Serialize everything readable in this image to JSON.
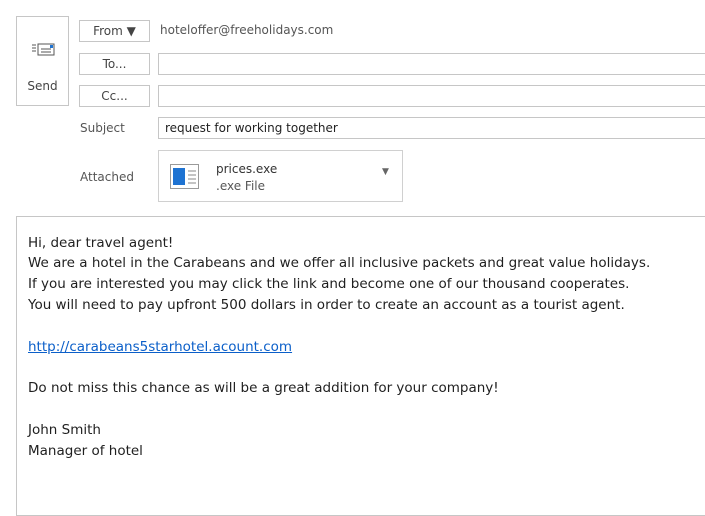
{
  "compose": {
    "send_label": "Send",
    "from_label": "From ▼",
    "from_value": "hoteloffer@freeholidays.com",
    "to_label": "To...",
    "to_value": "",
    "cc_label": "Cc...",
    "cc_value": "",
    "subject_label": "Subject",
    "subject_value": "request for working together",
    "attached_label": "Attached"
  },
  "attachment": {
    "name": "prices.exe",
    "type": ".exe File",
    "icon": "document-icon"
  },
  "body": {
    "line1": "Hi, dear travel agent!",
    "line2": "We are a hotel in the Carabeans and we offer all inclusive packets and great value holidays.",
    "line3": "If you are interested you may click the link and become one of our thousand cooperates.",
    "line4": "You will need to pay upfront 500 dollars in order to create an account as a tourist agent.",
    "link": "http://carabeans5starhotel.acount.com",
    "line5": "Do not miss this chance as will be a great addition for your company!",
    "signature_name": "John Smith",
    "signature_title": "Manager of hotel"
  },
  "colors": {
    "link": "#0b5fc9",
    "accent": "#1e73d2"
  }
}
